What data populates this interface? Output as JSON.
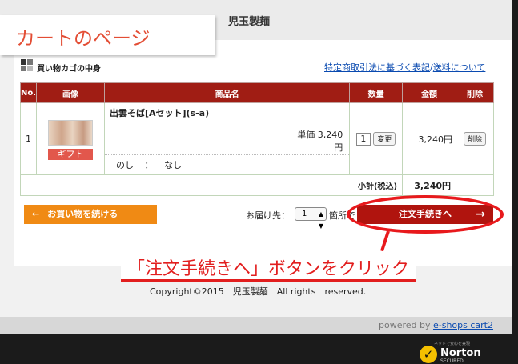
{
  "shop": {
    "name": "児玉製麺"
  },
  "callout": {
    "page_label": "カートのページ",
    "instruction": "「注文手続きへ」ボタンをクリック"
  },
  "cart": {
    "heading": "買い物カゴの中身",
    "links": {
      "tokutei": "特定商取引法に基づく表記",
      "separator": "/",
      "shipping": "送料について"
    },
    "columns": [
      "No.",
      "画像",
      "商品名",
      "数量",
      "金額",
      "削除"
    ],
    "items": [
      {
        "no": "1",
        "gift_label": "ギフト",
        "name": "出雲そば[Aセット](s-a)",
        "unit_price_label": "単価",
        "unit_price": "3,240",
        "currency": "円",
        "noshi_label": "のし",
        "noshi_sep": "：",
        "noshi_value": "なし",
        "qty": "1",
        "change_label": "変更",
        "amount": "3,240円",
        "delete_label": "削除"
      }
    ],
    "subtotal_label": "小計(税込)",
    "subtotal_value": "3,240円"
  },
  "actions": {
    "continue_label": "お買い物を続ける",
    "continue_icon": "arrow-left-icon",
    "deliver_label": "お届け先：",
    "deliver_value": "1",
    "deliver_suffix": "箇所で",
    "checkout_label": "注文手続きへ",
    "checkout_icon": "arrow-right-icon"
  },
  "footer": {
    "copyright": "Copyright©2015　児玉製麺　All rights　reserved.",
    "powered_by": "powered by",
    "powered_link": "e-shops cart2"
  },
  "badge": {
    "top": "ネットで安心を実現",
    "name": "Norton",
    "sub": "SECURED"
  },
  "colors": {
    "header_red": "#a01d14",
    "checkout_red": "#b0140e",
    "continue_orange": "#f08a14",
    "annotation_red": "#e8191c"
  }
}
